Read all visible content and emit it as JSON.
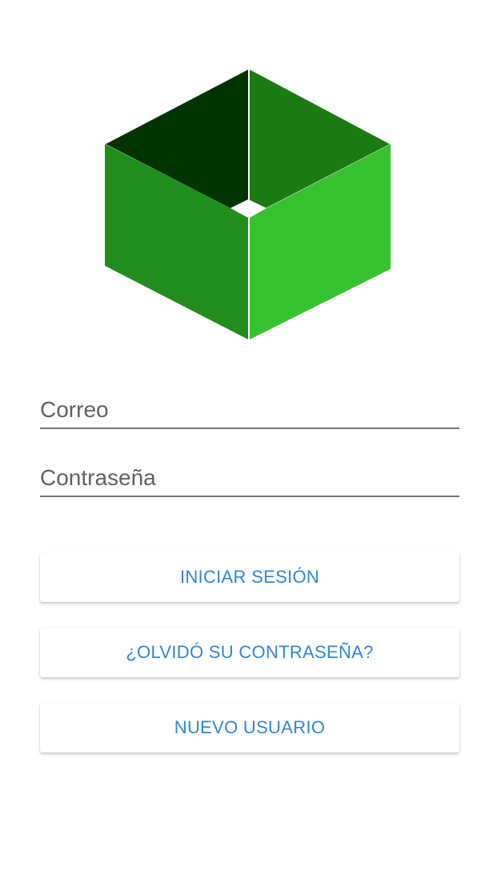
{
  "logo": {
    "icon": "open-box-logo",
    "colors": {
      "inner_left": "#023402",
      "inner_right": "#1b7a12",
      "outer_left": "#218d1c",
      "outer_right": "#37c12f",
      "hole": "#ffffff"
    }
  },
  "form": {
    "email_placeholder": "Correo",
    "password_placeholder": "Contraseña"
  },
  "buttons": {
    "login_label": "INICIAR SESIÓN",
    "forgot_label": "¿OLVIDÓ SU CONTRASEÑA?",
    "new_user_label": "NUEVO USUARIO"
  },
  "theme": {
    "accent": "#2f86d6",
    "underline": "#757575"
  }
}
